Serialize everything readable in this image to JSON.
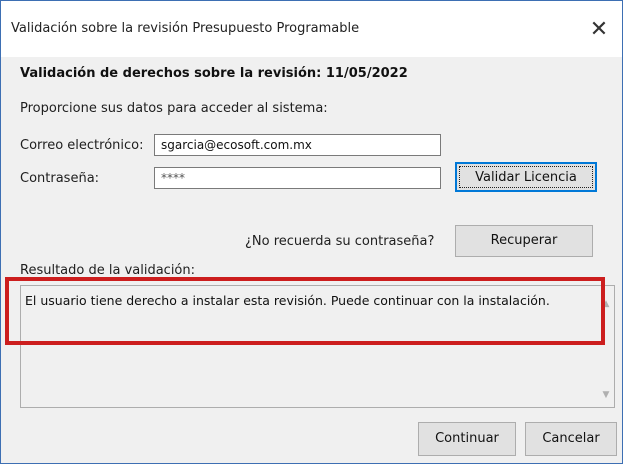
{
  "window": {
    "title": "Validación sobre la revisión Presupuesto Programable",
    "close_glyph": "✕"
  },
  "heading": "Validación de derechos sobre la revisión: 11/05/2022",
  "prompt": "Proporcione sus datos para acceder al sistema:",
  "email": {
    "label": "Correo electrónico:",
    "value": "sgarcia@ecosoft.com.mx"
  },
  "password": {
    "label": "Contraseña:",
    "value": "****"
  },
  "buttons": {
    "validate": "Validar Licencia",
    "recover": "Recuperar",
    "continue": "Continuar",
    "cancel": "Cancelar"
  },
  "forgot_text": "¿No recuerda su contraseña?",
  "result": {
    "label": "Resultado de la validación:",
    "text": "El usuario tiene derecho a instalar esta revisión. Puede continuar con la instalación."
  },
  "scroll": {
    "up_glyph": "▲",
    "down_glyph": "▼"
  },
  "colors": {
    "highlight": "#cc1e1e",
    "focus": "#0078d7",
    "border": "#3d6fb3"
  }
}
